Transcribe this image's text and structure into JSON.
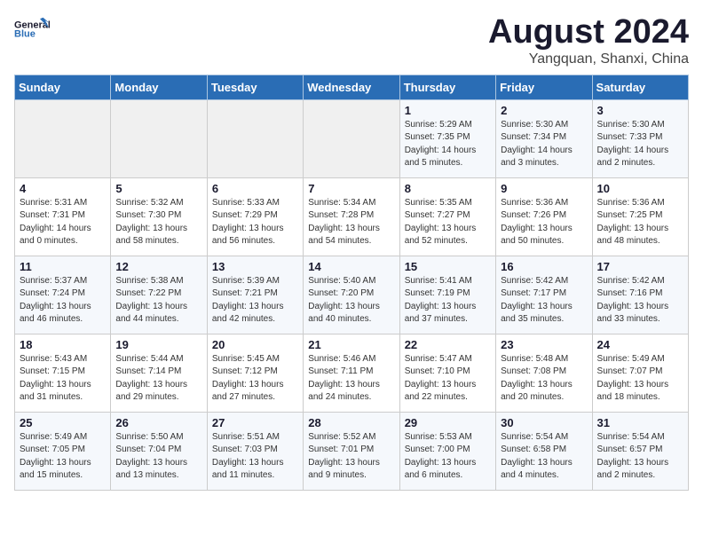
{
  "brand": {
    "name_general": "General",
    "name_blue": "Blue"
  },
  "title": {
    "month_year": "August 2024",
    "location": "Yangquan, Shanxi, China"
  },
  "days_of_week": [
    "Sunday",
    "Monday",
    "Tuesday",
    "Wednesday",
    "Thursday",
    "Friday",
    "Saturday"
  ],
  "weeks": [
    [
      {
        "day": "",
        "info": ""
      },
      {
        "day": "",
        "info": ""
      },
      {
        "day": "",
        "info": ""
      },
      {
        "day": "",
        "info": ""
      },
      {
        "day": "1",
        "info": "Sunrise: 5:29 AM\nSunset: 7:35 PM\nDaylight: 14 hours\nand 5 minutes."
      },
      {
        "day": "2",
        "info": "Sunrise: 5:30 AM\nSunset: 7:34 PM\nDaylight: 14 hours\nand 3 minutes."
      },
      {
        "day": "3",
        "info": "Sunrise: 5:30 AM\nSunset: 7:33 PM\nDaylight: 14 hours\nand 2 minutes."
      }
    ],
    [
      {
        "day": "4",
        "info": "Sunrise: 5:31 AM\nSunset: 7:31 PM\nDaylight: 14 hours\nand 0 minutes."
      },
      {
        "day": "5",
        "info": "Sunrise: 5:32 AM\nSunset: 7:30 PM\nDaylight: 13 hours\nand 58 minutes."
      },
      {
        "day": "6",
        "info": "Sunrise: 5:33 AM\nSunset: 7:29 PM\nDaylight: 13 hours\nand 56 minutes."
      },
      {
        "day": "7",
        "info": "Sunrise: 5:34 AM\nSunset: 7:28 PM\nDaylight: 13 hours\nand 54 minutes."
      },
      {
        "day": "8",
        "info": "Sunrise: 5:35 AM\nSunset: 7:27 PM\nDaylight: 13 hours\nand 52 minutes."
      },
      {
        "day": "9",
        "info": "Sunrise: 5:36 AM\nSunset: 7:26 PM\nDaylight: 13 hours\nand 50 minutes."
      },
      {
        "day": "10",
        "info": "Sunrise: 5:36 AM\nSunset: 7:25 PM\nDaylight: 13 hours\nand 48 minutes."
      }
    ],
    [
      {
        "day": "11",
        "info": "Sunrise: 5:37 AM\nSunset: 7:24 PM\nDaylight: 13 hours\nand 46 minutes."
      },
      {
        "day": "12",
        "info": "Sunrise: 5:38 AM\nSunset: 7:22 PM\nDaylight: 13 hours\nand 44 minutes."
      },
      {
        "day": "13",
        "info": "Sunrise: 5:39 AM\nSunset: 7:21 PM\nDaylight: 13 hours\nand 42 minutes."
      },
      {
        "day": "14",
        "info": "Sunrise: 5:40 AM\nSunset: 7:20 PM\nDaylight: 13 hours\nand 40 minutes."
      },
      {
        "day": "15",
        "info": "Sunrise: 5:41 AM\nSunset: 7:19 PM\nDaylight: 13 hours\nand 37 minutes."
      },
      {
        "day": "16",
        "info": "Sunrise: 5:42 AM\nSunset: 7:17 PM\nDaylight: 13 hours\nand 35 minutes."
      },
      {
        "day": "17",
        "info": "Sunrise: 5:42 AM\nSunset: 7:16 PM\nDaylight: 13 hours\nand 33 minutes."
      }
    ],
    [
      {
        "day": "18",
        "info": "Sunrise: 5:43 AM\nSunset: 7:15 PM\nDaylight: 13 hours\nand 31 minutes."
      },
      {
        "day": "19",
        "info": "Sunrise: 5:44 AM\nSunset: 7:14 PM\nDaylight: 13 hours\nand 29 minutes."
      },
      {
        "day": "20",
        "info": "Sunrise: 5:45 AM\nSunset: 7:12 PM\nDaylight: 13 hours\nand 27 minutes."
      },
      {
        "day": "21",
        "info": "Sunrise: 5:46 AM\nSunset: 7:11 PM\nDaylight: 13 hours\nand 24 minutes."
      },
      {
        "day": "22",
        "info": "Sunrise: 5:47 AM\nSunset: 7:10 PM\nDaylight: 13 hours\nand 22 minutes."
      },
      {
        "day": "23",
        "info": "Sunrise: 5:48 AM\nSunset: 7:08 PM\nDaylight: 13 hours\nand 20 minutes."
      },
      {
        "day": "24",
        "info": "Sunrise: 5:49 AM\nSunset: 7:07 PM\nDaylight: 13 hours\nand 18 minutes."
      }
    ],
    [
      {
        "day": "25",
        "info": "Sunrise: 5:49 AM\nSunset: 7:05 PM\nDaylight: 13 hours\nand 15 minutes."
      },
      {
        "day": "26",
        "info": "Sunrise: 5:50 AM\nSunset: 7:04 PM\nDaylight: 13 hours\nand 13 minutes."
      },
      {
        "day": "27",
        "info": "Sunrise: 5:51 AM\nSunset: 7:03 PM\nDaylight: 13 hours\nand 11 minutes."
      },
      {
        "day": "28",
        "info": "Sunrise: 5:52 AM\nSunset: 7:01 PM\nDaylight: 13 hours\nand 9 minutes."
      },
      {
        "day": "29",
        "info": "Sunrise: 5:53 AM\nSunset: 7:00 PM\nDaylight: 13 hours\nand 6 minutes."
      },
      {
        "day": "30",
        "info": "Sunrise: 5:54 AM\nSunset: 6:58 PM\nDaylight: 13 hours\nand 4 minutes."
      },
      {
        "day": "31",
        "info": "Sunrise: 5:54 AM\nSunset: 6:57 PM\nDaylight: 13 hours\nand 2 minutes."
      }
    ]
  ]
}
